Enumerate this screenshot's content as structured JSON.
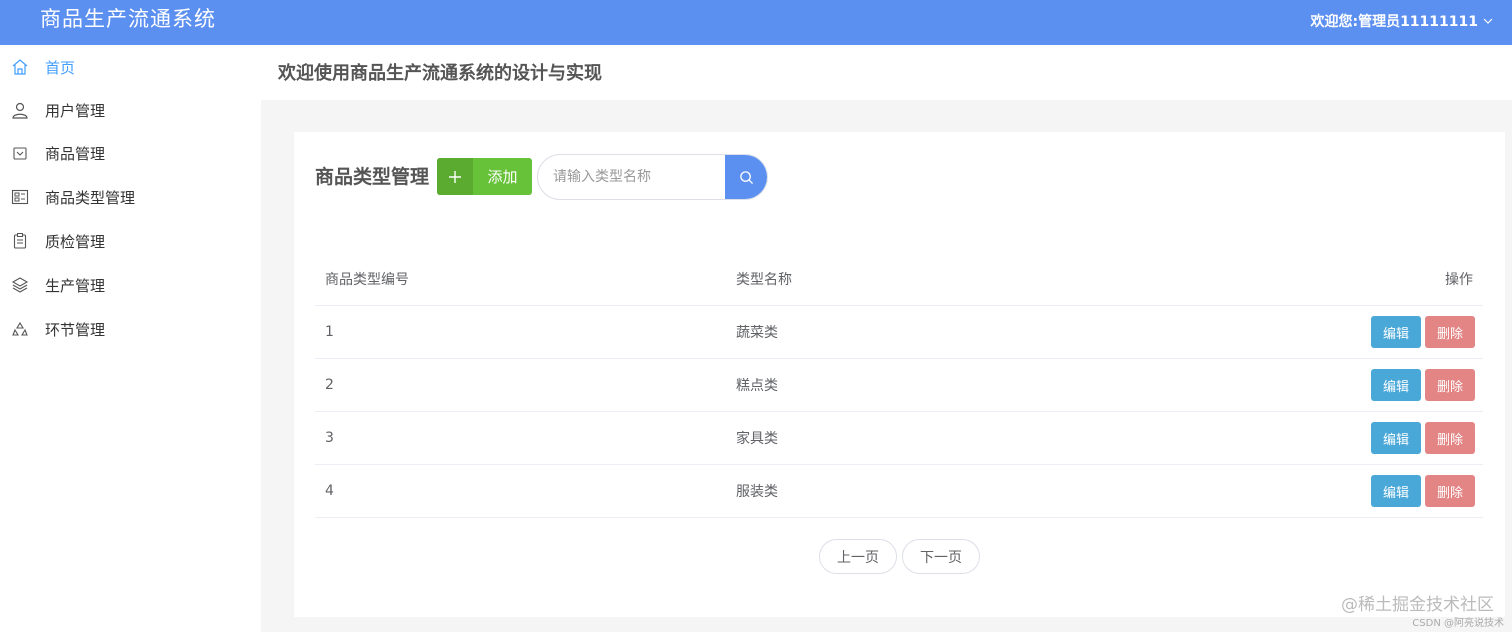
{
  "app": {
    "title": "商品生产流通系统",
    "user_label": "欢迎您:管理员11111111"
  },
  "colors": {
    "topbar": "#5b8ff0",
    "accent": "#409eff",
    "add": "#67c23a",
    "edit": "#4aa8d8",
    "delete": "#e38585"
  },
  "sidebar": {
    "items": [
      {
        "label": "首页",
        "icon": "home-icon"
      },
      {
        "label": "用户管理",
        "icon": "user-icon"
      },
      {
        "label": "商品管理",
        "icon": "goods-icon"
      },
      {
        "label": "商品类型管理",
        "icon": "type-icon"
      },
      {
        "label": "质检管理",
        "icon": "clipboard-icon"
      },
      {
        "label": "生产管理",
        "icon": "layers-icon"
      },
      {
        "label": "环节管理",
        "icon": "recycle-icon"
      }
    ]
  },
  "header": {
    "welcome": "欢迎使用商品生产流通系统的设计与实现"
  },
  "main": {
    "title": "商品类型管理",
    "add_label": "添加",
    "search": {
      "placeholder": "请输入类型名称",
      "value": ""
    },
    "table": {
      "columns": [
        "商品类型编号",
        "类型名称",
        "操作"
      ],
      "rows": [
        {
          "id": "1",
          "name": "蔬菜类"
        },
        {
          "id": "2",
          "name": "糕点类"
        },
        {
          "id": "3",
          "name": "家具类"
        },
        {
          "id": "4",
          "name": "服装类"
        }
      ],
      "edit_label": "编辑",
      "delete_label": "删除"
    },
    "pager": {
      "prev": "上一页",
      "next": "下一页"
    }
  },
  "watermark": {
    "main": "@稀土掘金技术社区",
    "sub": "CSDN @阿亮说技术"
  }
}
